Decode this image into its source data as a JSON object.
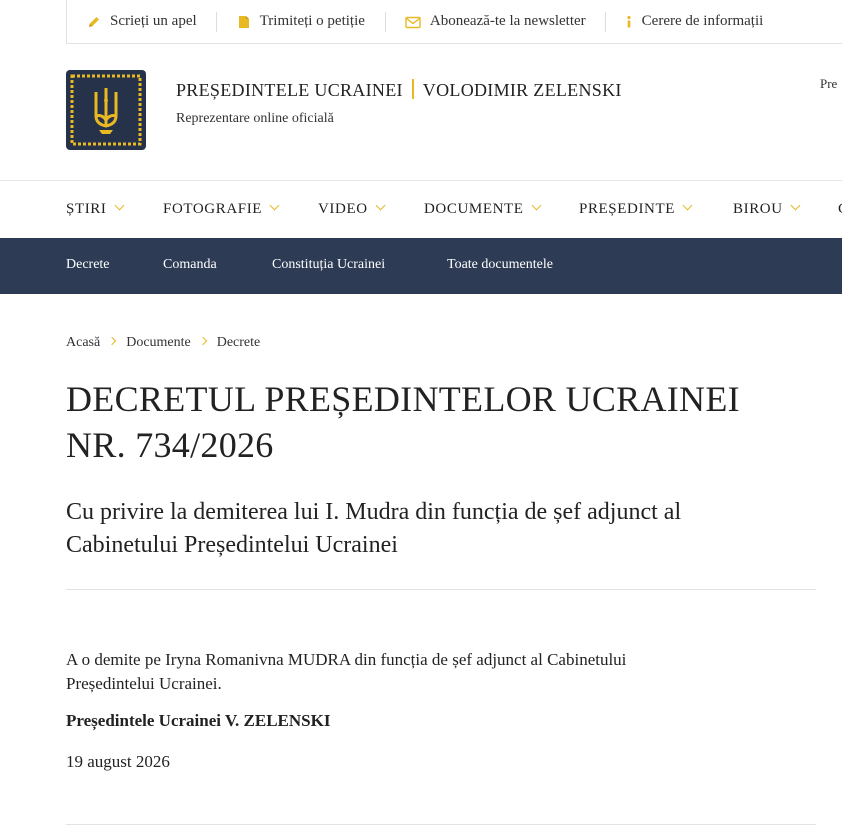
{
  "topbar": {
    "items": [
      {
        "label": "Scrieți un apel",
        "icon": "pencil-icon"
      },
      {
        "label": "Trimiteți o petiție",
        "icon": "document-icon"
      },
      {
        "label": "Abonează-te la newsletter",
        "icon": "envelope-icon"
      },
      {
        "label": "Cerere de informații",
        "icon": "info-icon"
      }
    ]
  },
  "header": {
    "title_left": "PREȘEDINTELE UCRAINEI",
    "title_right": "VOLODIMIR ZELENSKI",
    "subtitle": "Reprezentare online oficială",
    "cut_text": "Pre",
    "logo_icon": "trident-emblem-icon"
  },
  "nav": {
    "items": [
      "ȘTIRI",
      "FOTOGRAFIE",
      "VIDEO",
      "DOCUMENTE",
      "PREȘEDINTE",
      "BIROU",
      "C"
    ]
  },
  "subnav": {
    "items": [
      "Decrete",
      "Comanda",
      "Constituția Ucrainei",
      "Toate documentele"
    ]
  },
  "breadcrumb": [
    "Acasă",
    "Documente",
    "Decrete"
  ],
  "article": {
    "title_line1": "DECRETUL PREȘEDINTELOR UCRAINEI",
    "title_line2": "NR. 734/2026",
    "subtitle_line1": "Cu privire la demiterea lui I. Mudra din funcția de șef adjunct al",
    "subtitle_line2": "Cabinetului Președintelui Ucrainei",
    "body_line1": "A o demite pe Iryna Romanivna MUDRA din funcția de șef adjunct al Cabinetului",
    "body_line2": "Președintelui Ucrainei.",
    "signature": "Președintele Ucrainei V. ZELENSKI",
    "date": "19 august 2026"
  },
  "colors": {
    "accent": "#e8b923",
    "navy": "#2e3b55",
    "logo_bg": "#25324a"
  }
}
